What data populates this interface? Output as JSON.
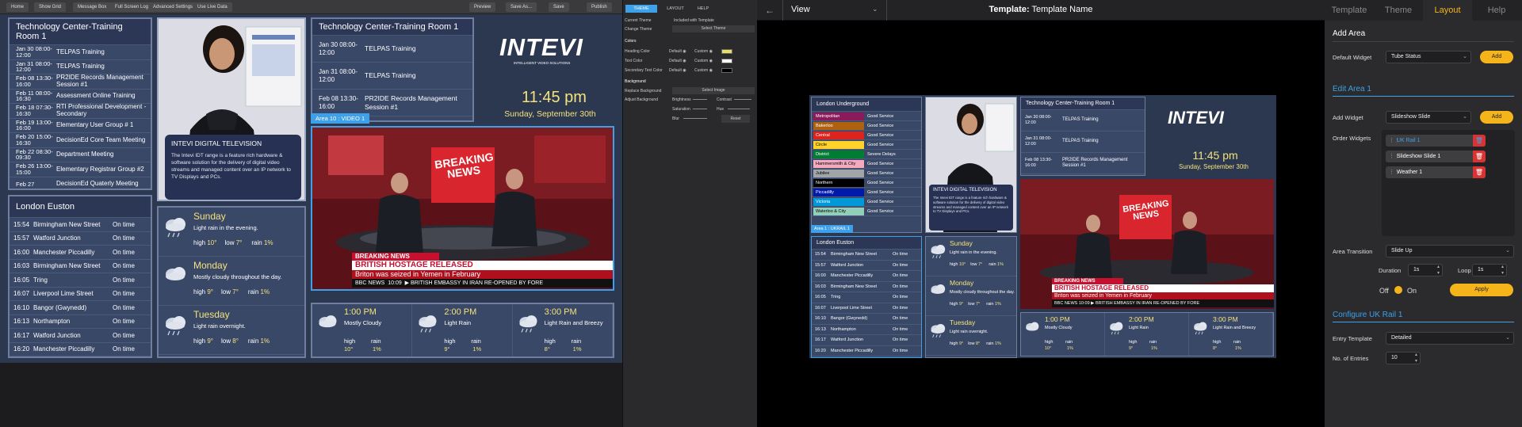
{
  "left_editor": {
    "toolbar": {
      "buttons": [
        "Home",
        "Show Grid",
        "Message Box",
        "Full Screen Logo",
        "Advanced Settings",
        "Use Live Data"
      ],
      "right_buttons": [
        "Preview",
        "Save As...",
        "Save",
        "Publish"
      ]
    },
    "training_panel": {
      "title": "Technology Center-Training Room 1",
      "events": [
        {
          "time": "Jan 30 08:00-12:00",
          "name": "TELPAS Training"
        },
        {
          "time": "Jan 31 08:00-12:00",
          "name": "TELPAS Training"
        },
        {
          "time": "Feb 08 13:30-16:00",
          "name": "PR2IDE Records Management Session #1"
        },
        {
          "time": "Feb 11 08:00-16:30",
          "name": "Assessment Online Training"
        },
        {
          "time": "Feb 18 07:30-16:30",
          "name": "RTI Professional Development - Secondary"
        },
        {
          "time": "Feb 19 13:00-16:00",
          "name": "Elementary User Group # 1"
        },
        {
          "time": "Feb 20 15:00-16:30",
          "name": "DecisionEd Core Team Meeting"
        },
        {
          "time": "Feb 22 08:30-09:30",
          "name": "Department Meeting"
        },
        {
          "time": "Feb 26 13:00-15:00",
          "name": "Elementary Registrar Group #2"
        },
        {
          "time": "Feb 27",
          "name": "DecisionEd Quaterly Meeting"
        }
      ]
    },
    "training_panel2": {
      "title": "Technology Center-Training Room 1",
      "events": [
        {
          "time": "Jan 30 08:00-12:00",
          "name": "TELPAS Training"
        },
        {
          "time": "Jan 31 08:00-12:00",
          "name": "TELPAS Training"
        },
        {
          "time": "Feb 08 13:30-16:00",
          "name": "PR2IDE Records Management Session #1"
        }
      ]
    },
    "logo": {
      "brand": "INTEVI",
      "tagline": "INTELLIGENT VIDEO SOLUTIONS"
    },
    "clock": {
      "time": "11:45 pm",
      "date": "Sunday, September 30th"
    },
    "presenter": {
      "title": "INTEVI DIGITAL TELEVISION",
      "body": "The Intevi IDT range is a feature rich hardware & software solution for the delivery of digital video streams and managed content over an IP network to TV Displays and PCs."
    },
    "video_label": "Area 10 : VIDEO 1",
    "news": {
      "screen": "BREAKING NEWS",
      "banner": "BREAKING NEWS",
      "headline": "BRITISH HOSTAGE RELEASED",
      "sub": "Briton was seized in Yemen in February",
      "channel": "BBC NEWS",
      "clock": "10:09",
      "ticker": "BRITISH EMBASSY IN IRAN RE-OPENED BY FORE"
    },
    "euston": {
      "title": "London Euston",
      "rows": [
        {
          "t": "15:54",
          "dest": "Birmingham New Street",
          "status": "On time"
        },
        {
          "t": "15:57",
          "dest": "Watford Junction",
          "status": "On time"
        },
        {
          "t": "16:00",
          "dest": "Manchester Piccadilly",
          "status": "On time"
        },
        {
          "t": "16:03",
          "dest": "Birmingham New Street",
          "status": "On time"
        },
        {
          "t": "16:05",
          "dest": "Tring",
          "status": "On time"
        },
        {
          "t": "16:07",
          "dest": "Liverpool Lime Street",
          "status": "On time"
        },
        {
          "t": "16:10",
          "dest": "Bangor (Gwynedd)",
          "status": "On time"
        },
        {
          "t": "16:13",
          "dest": "Northampton",
          "status": "On time"
        },
        {
          "t": "16:17",
          "dest": "Watford Junction",
          "status": "On time"
        },
        {
          "t": "16:20",
          "dest": "Manchester Piccadilly",
          "status": "On time"
        }
      ]
    },
    "weather_days": [
      {
        "day": "Sunday",
        "desc": "Light rain in the evening.",
        "high_label": "high",
        "high": "10°",
        "low_label": "low",
        "low": "7°",
        "rain_label": "rain",
        "rain": "1%",
        "icon": "rain-cloud-icon"
      },
      {
        "day": "Monday",
        "desc": "Mostly cloudy throughout the day.",
        "high_label": "high",
        "high": "9°",
        "low_label": "low",
        "low": "7°",
        "rain_label": "rain",
        "rain": "1%",
        "icon": "cloud-icon"
      },
      {
        "day": "Tuesday",
        "desc": "Light rain overnight.",
        "high_label": "high",
        "high": "9°",
        "low_label": "low",
        "low": "8°",
        "rain_label": "rain",
        "rain": "1%",
        "icon": "rain-cloud-icon"
      }
    ],
    "weather_hours": [
      {
        "time": "1:00 PM",
        "desc": "Mostly Cloudy",
        "high_label": "high",
        "high": "10°",
        "rain_label": "rain",
        "rain": "1%"
      },
      {
        "time": "2:00 PM",
        "desc": "Light Rain",
        "high_label": "high",
        "high": "9°",
        "rain_label": "rain",
        "rain": "1%"
      },
      {
        "time": "3:00 PM",
        "desc": "Light Rain and Breezy",
        "high_label": "high",
        "high": "8°",
        "rain_label": "rain",
        "rain": "1%"
      }
    ]
  },
  "theme_panel": {
    "tabs": [
      "THEME",
      "LAYOUT",
      "HELP"
    ],
    "current_theme_label": "Current Theme",
    "current_theme_value": "Included with Template",
    "change_theme_label": "Change Theme",
    "select_theme": "Select Theme",
    "colors_heading": "Colors",
    "color_rows": [
      {
        "label": "Heading Color",
        "default": "Default",
        "custom": "Custom",
        "swatch": "#e8e060"
      },
      {
        "label": "Text Color",
        "default": "Default",
        "custom": "Custom",
        "swatch": "#ffffff"
      },
      {
        "label": "Secondary Text Color",
        "default": "Default",
        "custom": "Custom",
        "swatch": "#000000"
      }
    ],
    "background_heading": "Background",
    "replace_bg_label": "Replace Background",
    "select_image": "Select Image",
    "adjust_bg_label": "Adjust Background",
    "adjust": [
      "Brightness",
      "Contrast",
      "Saturation",
      "Hue",
      "Blur"
    ],
    "reset": "Reset"
  },
  "middle": {
    "view_label": "View",
    "template_label": "Template:",
    "template_name": "Template Name",
    "underground": {
      "title": "London Underground",
      "lines": [
        {
          "name": "Metropolitan",
          "status": "Good Service",
          "color": "#8b1a5a"
        },
        {
          "name": "Bakerloo",
          "status": "Good Service",
          "color": "#b06110"
        },
        {
          "name": "Central",
          "status": "Good Service",
          "color": "#dc241f"
        },
        {
          "name": "Circle",
          "status": "Good Service",
          "color": "#ffd329"
        },
        {
          "name": "District",
          "status": "Severe Delays",
          "color": "#007d32"
        },
        {
          "name": "Hammersmith & City",
          "status": "Good Service",
          "color": "#f4a9be"
        },
        {
          "name": "Jubilee",
          "status": "Good Service",
          "color": "#a1a5a7"
        },
        {
          "name": "Northern",
          "status": "Good Service",
          "color": "#000000"
        },
        {
          "name": "Piccadilly",
          "status": "Good Service",
          "color": "#0019a8"
        },
        {
          "name": "Victoria",
          "status": "Good Service",
          "color": "#0098d8"
        },
        {
          "name": "Waterloo & City",
          "status": "Good Service",
          "color": "#93ceba"
        }
      ],
      "area_label": "Area 1 : UKRAIL 1"
    }
  },
  "right_panel": {
    "tabs": [
      "Template",
      "Theme",
      "Layout",
      "Help"
    ],
    "active_tab": "Layout",
    "add_area": "Add Area",
    "default_widget_label": "Default Widget",
    "default_widget_value": "Tube Status",
    "add_btn": "Add",
    "edit_area": "Edit Area 1",
    "add_widget_label": "Add Widget",
    "add_widget_value": "Slideshow Slide",
    "add_btn2": "Add",
    "order_widgets_label": "Order Widgets",
    "order_widgets": [
      "UK Rail 1",
      "Slideshow Slide 1",
      "Weather 1"
    ],
    "area_transition_label": "Area Transition",
    "area_transition_value": "Slide Up",
    "duration_label": "Duration",
    "duration_value": "1s",
    "loop_label": "Loop",
    "loop_value": "1s",
    "off_label": "Off",
    "on_label": "On",
    "apply": "Apply",
    "configure": "Configure UK Rail 1",
    "entry_template_label": "Entry Template",
    "entry_template_value": "Detailed",
    "entries_label": "No. of Entries",
    "entries_value": "10"
  },
  "colors": {
    "accent": "#f5b51a",
    "selected": "#3da0e8",
    "panel": "#3a4868"
  }
}
